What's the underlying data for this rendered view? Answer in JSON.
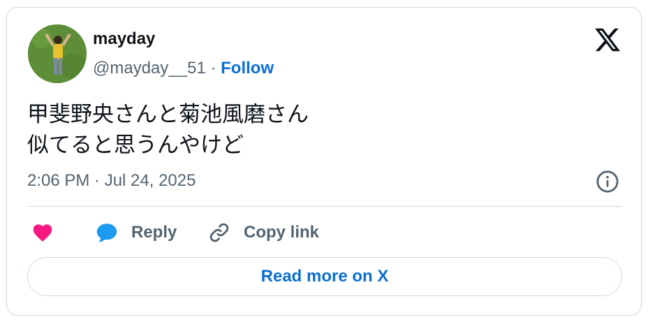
{
  "author": {
    "name": "mayday",
    "handle": "@mayday__51",
    "separator": "·",
    "follow_label": "Follow"
  },
  "tweet": {
    "lines": [
      "甲斐野央さんと菊池風磨さん",
      "似てると思うんやけど"
    ],
    "timestamp": "2:06 PM · Jul 24, 2025"
  },
  "actions": {
    "like_icon": "heart-icon",
    "reply_label": "Reply",
    "copy_label": "Copy link"
  },
  "read_more_label": "Read more on X",
  "colors": {
    "like": "#f91880",
    "reply": "#1d9bf0",
    "link": "#0b6fd1",
    "muted": "#536471",
    "border": "#cfd9de"
  }
}
